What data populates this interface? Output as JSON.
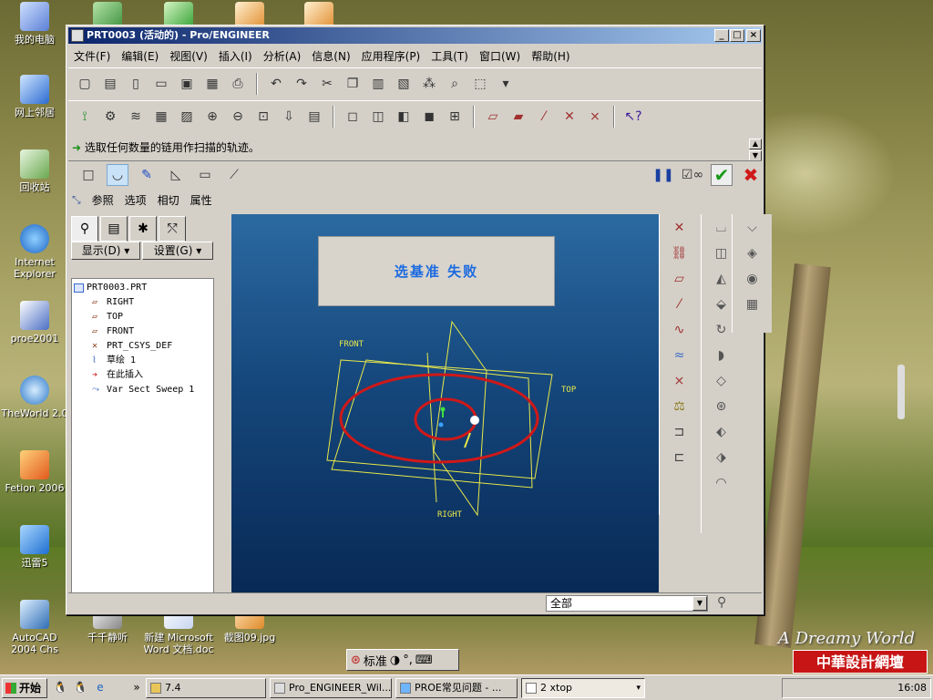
{
  "desktop": {
    "icons": [
      {
        "label": "我的电脑",
        "icon": "my-computer-icon"
      },
      {
        "label": "网上邻居",
        "icon": "network-icon"
      },
      {
        "label": "回收站",
        "icon": "recycle-bin-icon"
      },
      {
        "label": "Internet Explorer",
        "icon": "ie-icon"
      },
      {
        "label": "proe2001",
        "icon": "proe-shortcut-icon"
      },
      {
        "label": "TheWorld 2.0",
        "icon": "theworld-icon"
      },
      {
        "label": "Fetion 2006",
        "icon": "fetion-icon"
      },
      {
        "label": "迅雷5",
        "icon": "thunder-icon"
      },
      {
        "label": "AutoCAD 2004 Chs",
        "icon": "autocad-icon"
      },
      {
        "label": "千千静听",
        "icon": "ttplayer-icon"
      },
      {
        "label": "新建 Microsoft Word 文档.doc",
        "icon": "word-doc-icon"
      },
      {
        "label": "截图09.jpg",
        "icon": "jpg-icon"
      }
    ],
    "watermark": "A Dreamy World",
    "cn_watermark": "中華設計網壇"
  },
  "window": {
    "title": "PRT0003 (活动的) - Pro/ENGINEER",
    "controls": {
      "minimize": "_",
      "maximize": "□",
      "close": "×"
    }
  },
  "menu": [
    "文件(F)",
    "编辑(E)",
    "视图(V)",
    "插入(I)",
    "分析(A)",
    "信息(N)",
    "应用程序(P)",
    "工具(T)",
    "窗口(W)",
    "帮助(H)"
  ],
  "message": "选取任何数量的链用作扫描的轨迹。",
  "dashboard_tabs": [
    "参照",
    "选项",
    "相切",
    "属性"
  ],
  "model_tree": {
    "show_label": "显示(D)",
    "settings_label": "设置(G)",
    "root": "PRT0003.PRT",
    "items": [
      {
        "label": "RIGHT",
        "icon": "datum-plane-icon"
      },
      {
        "label": "TOP",
        "icon": "datum-plane-icon"
      },
      {
        "label": "FRONT",
        "icon": "datum-plane-icon"
      },
      {
        "label": "PRT_CSYS_DEF",
        "icon": "csys-icon"
      },
      {
        "label": "草绘 1",
        "icon": "sketch-icon"
      },
      {
        "label": "在此插入",
        "icon": "insert-arrow-icon"
      },
      {
        "label": "Var Sect Sweep 1",
        "icon": "sweep-icon"
      }
    ]
  },
  "viewport": {
    "error_message": "选基准   失败",
    "labels": {
      "front": "FRONT",
      "top": "TOP",
      "right": "RIGHT"
    }
  },
  "status": {
    "filter": "全部"
  },
  "ime": {
    "mode": "标准"
  },
  "taskbar": {
    "start": "开始",
    "tasks": [
      {
        "label": "7.4",
        "icon": "folder-icon"
      },
      {
        "label": "Pro_ENGINEER_Wil...",
        "icon": "proe-task-icon"
      },
      {
        "label": "PROE常见问题 - ...",
        "icon": "ie-task-icon"
      },
      {
        "label": "2 xtop",
        "icon": "xtop-icon"
      }
    ],
    "clock": "16:08"
  }
}
